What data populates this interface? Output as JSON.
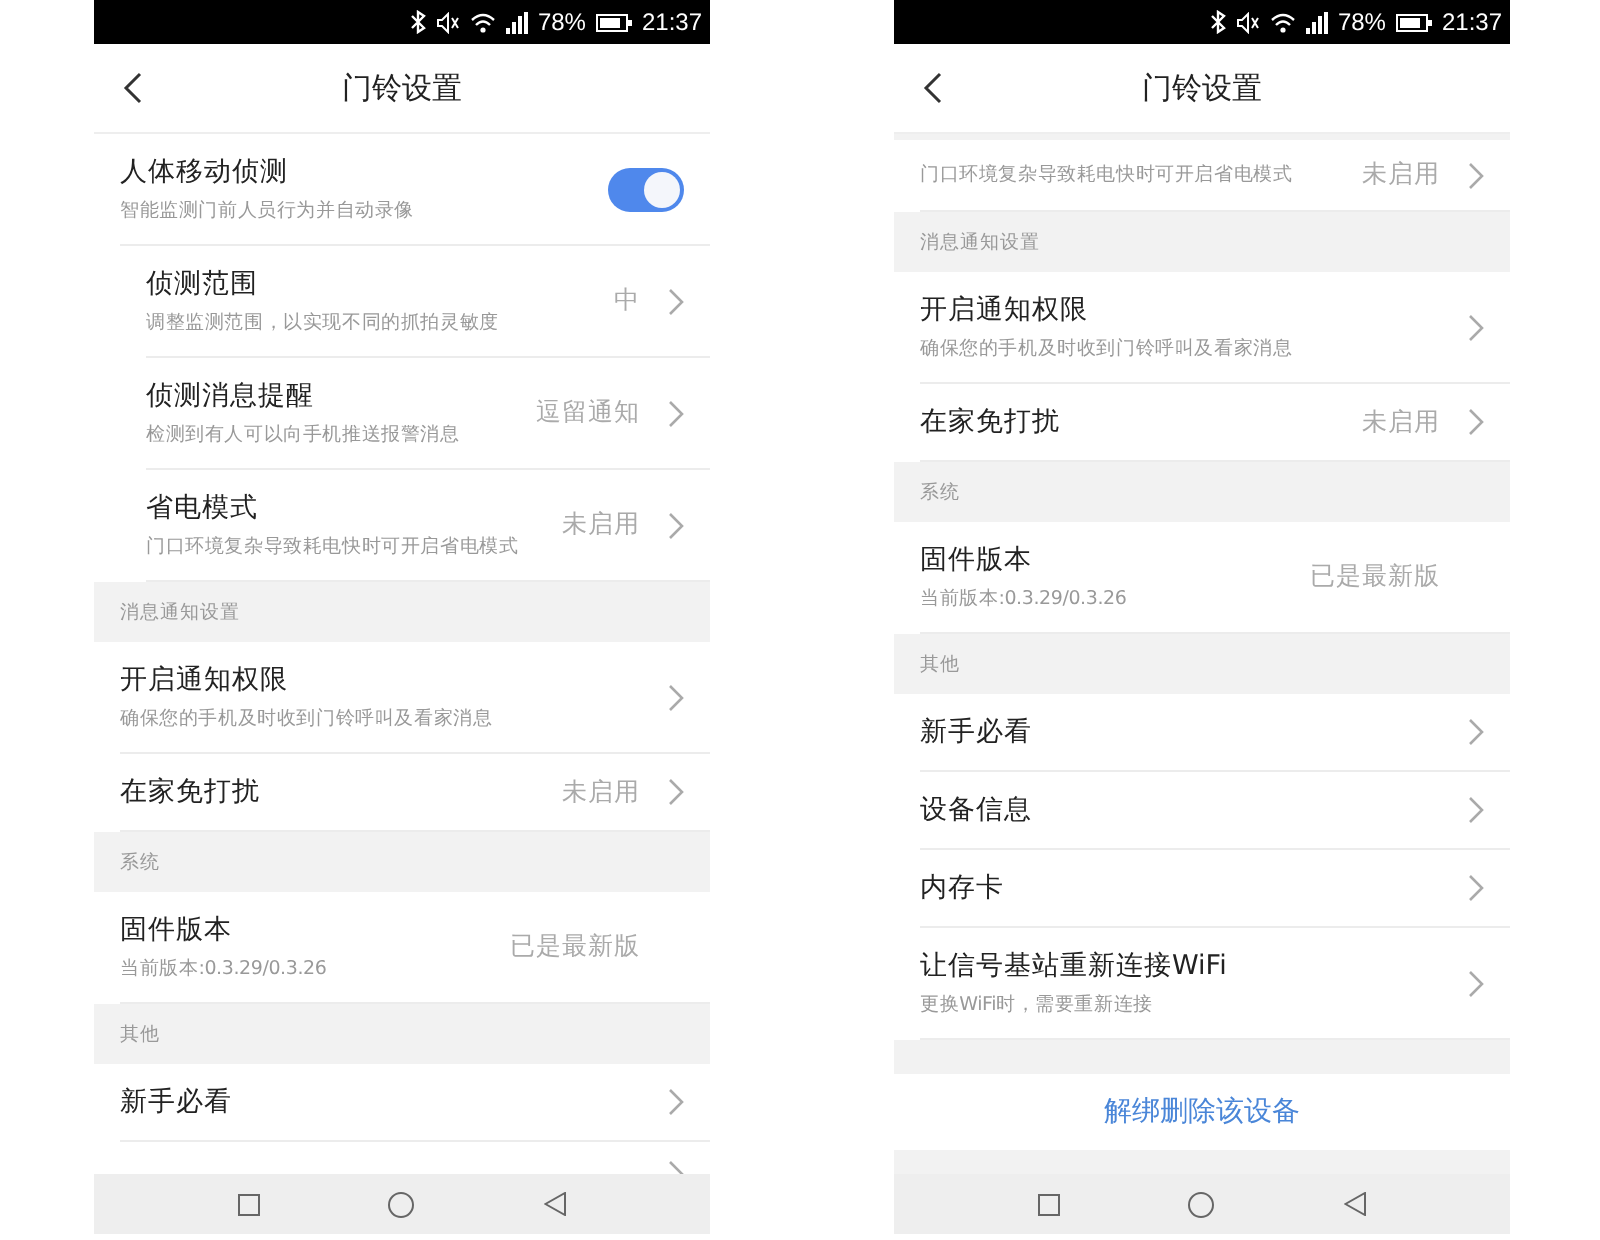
{
  "screens": [
    {
      "status_bar": {
        "battery": "78%",
        "time": "21:37"
      },
      "header": {
        "title": "门铃设置"
      },
      "sections": [
        {
          "items": [
            {
              "kind": "toggle",
              "title": "人体移动侦测",
              "subtitle": "智能监测门前人员行为并自动录像",
              "on": true,
              "children": [
                {
                  "kind": "link",
                  "title": "侦测范围",
                  "subtitle": "调整监测范围，以实现不同的抓拍灵敏度",
                  "value": "中"
                },
                {
                  "kind": "link",
                  "title": "侦测消息提醒",
                  "subtitle": "检测到有人可以向手机推送报警消息",
                  "value": "逗留通知"
                },
                {
                  "kind": "link",
                  "title": "省电模式",
                  "subtitle": "门口环境复杂导致耗电快时可开启省电模式",
                  "value": "未启用"
                }
              ]
            }
          ]
        },
        {
          "heading": "消息通知设置",
          "items": [
            {
              "kind": "link",
              "title": "开启通知权限",
              "subtitle": "确保您的手机及时收到门铃呼叫及看家消息"
            },
            {
              "kind": "link",
              "title": "在家免打扰",
              "value": "未启用"
            }
          ]
        },
        {
          "heading": "系统",
          "items": [
            {
              "kind": "info",
              "title": "固件版本",
              "subtitle": "当前版本:0.3.29/0.3.26",
              "value": "已是最新版"
            }
          ]
        },
        {
          "heading": "其他",
          "items": [
            {
              "kind": "link",
              "title": "新手必看"
            },
            {
              "kind": "link"
            }
          ]
        }
      ]
    },
    {
      "status_bar": {
        "battery": "78%",
        "time": "21:37"
      },
      "header": {
        "title": "门铃设置"
      },
      "sections": [
        {
          "items": [
            {
              "kind": "link",
              "subtitle": "门口环境复杂导致耗电快时可开启省电模式",
              "value": "未启用"
            }
          ]
        },
        {
          "heading": "消息通知设置",
          "items": [
            {
              "kind": "link",
              "title": "开启通知权限",
              "subtitle": "确保您的手机及时收到门铃呼叫及看家消息"
            },
            {
              "kind": "link",
              "title": "在家免打扰",
              "value": "未启用"
            }
          ]
        },
        {
          "heading": "系统",
          "items": [
            {
              "kind": "info",
              "title": "固件版本",
              "subtitle": "当前版本:0.3.29/0.3.26",
              "value": "已是最新版"
            }
          ]
        },
        {
          "heading": "其他",
          "items": [
            {
              "kind": "link",
              "title": "新手必看"
            },
            {
              "kind": "link",
              "title": "设备信息"
            },
            {
              "kind": "link",
              "title": "内存卡"
            },
            {
              "kind": "link",
              "title": "让信号基站重新连接WiFi",
              "subtitle": "更换WiFi时，需要重新连接"
            }
          ]
        }
      ],
      "action": "解绑删除该设备"
    }
  ]
}
